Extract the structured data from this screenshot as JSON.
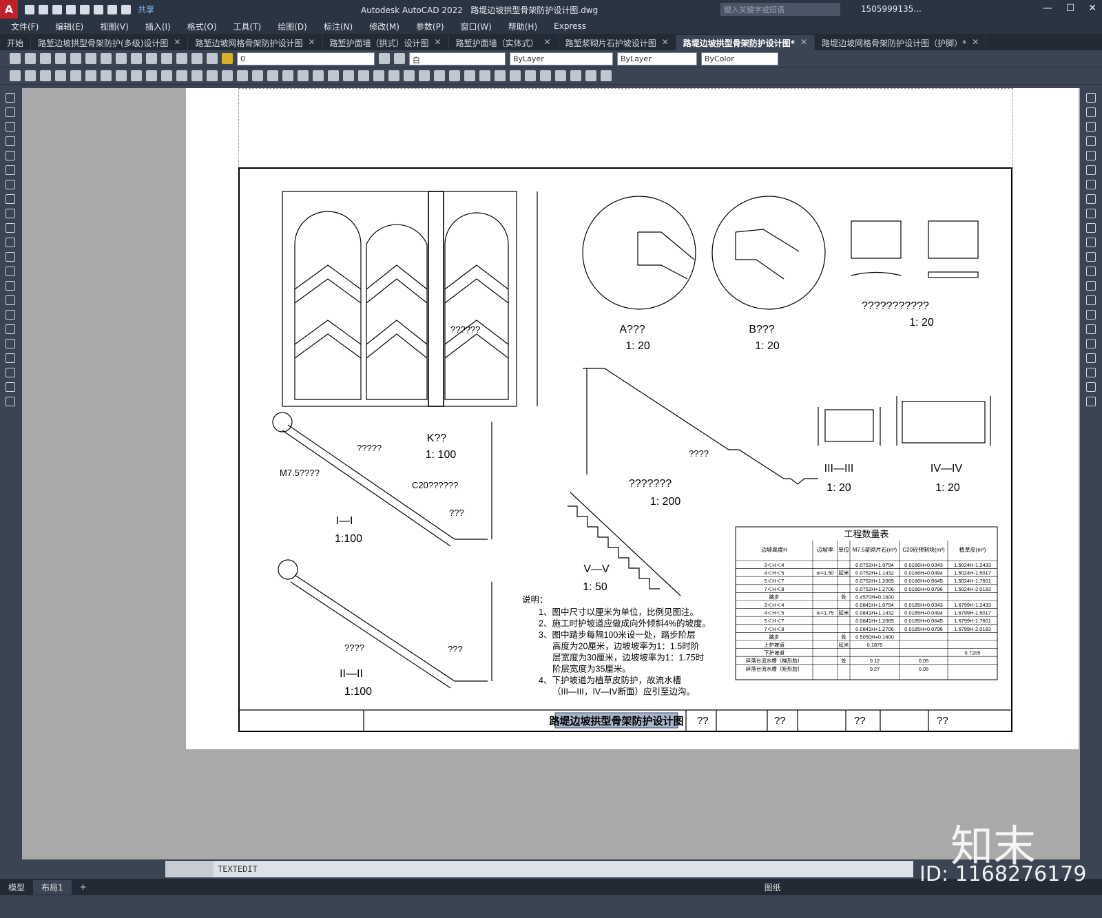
{
  "app": {
    "logo": "A",
    "title": "Autodesk AutoCAD 2022",
    "file": "路堤边坡拱型骨架防护设计图.dwg",
    "search_placeholder": "键入关键字或短语",
    "user": "1505999135...",
    "share": "共享"
  },
  "menu": [
    "文件(F)",
    "编辑(E)",
    "视图(V)",
    "插入(I)",
    "格式(O)",
    "工具(T)",
    "绘图(D)",
    "标注(N)",
    "修改(M)",
    "参数(P)",
    "窗口(W)",
    "帮助(H)",
    "Express"
  ],
  "tabs": [
    {
      "label": "开始",
      "close": false
    },
    {
      "label": "路堑边坡拱型骨架防护(多级)设计图",
      "close": true
    },
    {
      "label": "路堑边坡网格骨架防护设计图",
      "close": true
    },
    {
      "label": "路堑护面墙（拱式）设计图",
      "close": true
    },
    {
      "label": "路堑护面墙（实体式）",
      "close": true
    },
    {
      "label": "路堑浆砌片石护坡设计图",
      "close": true
    },
    {
      "label": "路堤边坡拱型骨架防护设计图*",
      "close": true,
      "active": true
    },
    {
      "label": "路堤边坡网格骨架防护设计图（护脚）*",
      "close": true
    }
  ],
  "props": {
    "layer": "0",
    "color": "白",
    "linetype": "ByLayer",
    "lineweight": "ByLayer",
    "plot": "ByColor"
  },
  "drawing": {
    "labels": {
      "A_title": "A???",
      "A_scale": "1: 20",
      "B_title": "B???",
      "B_scale": "1: 20",
      "detail_title": "???????????",
      "detail_scale": "1: 20",
      "K_title": "K??",
      "K_scale": "1: 100",
      "I_title": "I—I",
      "I_scale": "1:100",
      "II_title": "II—II",
      "II_scale": "1:100",
      "slope_title": "???????",
      "slope_scale": "1: 200",
      "V_title": "V—V",
      "V_scale": "1: 50",
      "III_title": "III—III",
      "III_scale": "1: 20",
      "IV_title": "IV—IV",
      "IV_scale": "1: 20",
      "m75": "M7.5????",
      "c20": "C20??????",
      "q5": "?????",
      "q3": "???",
      "q4": "????",
      "q7": "??????"
    },
    "notes_title": "说明：",
    "notes": [
      "1、图中尺寸以厘米为单位，比例见图注。",
      "2、施工时护坡道应做成向外倾斜4%的坡度。",
      "3、图中踏步每隔100米设一处，踏步阶层",
      "高度为20厘米，边坡坡率为1：1.5时阶",
      "层宽度为30厘米，边坡坡率为1：1.75时",
      "阶层宽度为35厘米。",
      "4、下护坡道为植草皮防护，故流水槽",
      "（III—III，IV—IV断面）应引至边沟。"
    ],
    "table": {
      "title": "工程数量表",
      "headers": [
        "边坡高度H",
        "边坡率",
        "单位",
        "M7.5浆砌片石(m³)",
        "C20砼预制块(m³)",
        "植草皮(m²)"
      ],
      "rows": [
        [
          "3＜H＜4",
          "",
          "",
          "0.0752H+1.0794",
          "0.0166H+0.0343",
          "1.5024H-1.2433"
        ],
        [
          "4＜H＜5",
          "m=1.50",
          "延米",
          "0.0752H+1.1432",
          "0.0166H+0.0494",
          "1.5024H-1.5017"
        ],
        [
          "5＜H＜7",
          "",
          "",
          "0.0752H+1.2069",
          "0.0166H+0.0645",
          "1.5024H-1.7601"
        ],
        [
          "7＜H＜8",
          "",
          "",
          "0.0752H+1.2706",
          "0.0166H+0.0796",
          "1.5024H-2.0183"
        ],
        [
          "踏步",
          "",
          "处",
          "0.4570H+0.1600",
          "",
          ""
        ],
        [
          "3＜H＜4",
          "",
          "",
          "0.0841H+1.0794",
          "0.0185H+0.0343",
          "1.6799H-1.2433"
        ],
        [
          "4＜H＜5",
          "m=1.75",
          "延米",
          "0.0841H+1.1432",
          "0.0185H+0.0494",
          "1.6799H-1.5017"
        ],
        [
          "5＜H＜7",
          "",
          "",
          "0.0841H+1.2069",
          "0.0185H+0.0645",
          "1.6799H-1.7601"
        ],
        [
          "7＜H＜8",
          "",
          "",
          "0.0841H+1.2706",
          "0.0185H+0.0796",
          "1.6799H-2.0183"
        ],
        [
          "踏步",
          "",
          "处",
          "0.5050H+0.1600",
          "",
          ""
        ],
        [
          "上护坡道",
          "",
          "延米",
          "0.1875",
          "",
          ""
        ],
        [
          "下护坡道",
          "",
          "",
          "",
          "",
          "0.7205"
        ],
        [
          "碎落台流水槽（梯形肋）",
          "",
          "处",
          "0.12",
          "0.05",
          ""
        ],
        [
          "碎落台流水槽（矩形肋）",
          "",
          "",
          "0.27",
          "0.05",
          ""
        ]
      ]
    },
    "titleblock": {
      "name": "路堤边坡拱型骨架防护设计图",
      "c1": "??",
      "c2": "??",
      "c3": "??",
      "c4": "??"
    }
  },
  "command": "TEXTEDIT",
  "layout_tabs": [
    "模型",
    "布局1",
    "+"
  ],
  "status": {
    "paper": "图纸"
  },
  "watermark": {
    "brand": "知末",
    "id": "ID: 1168276179"
  }
}
